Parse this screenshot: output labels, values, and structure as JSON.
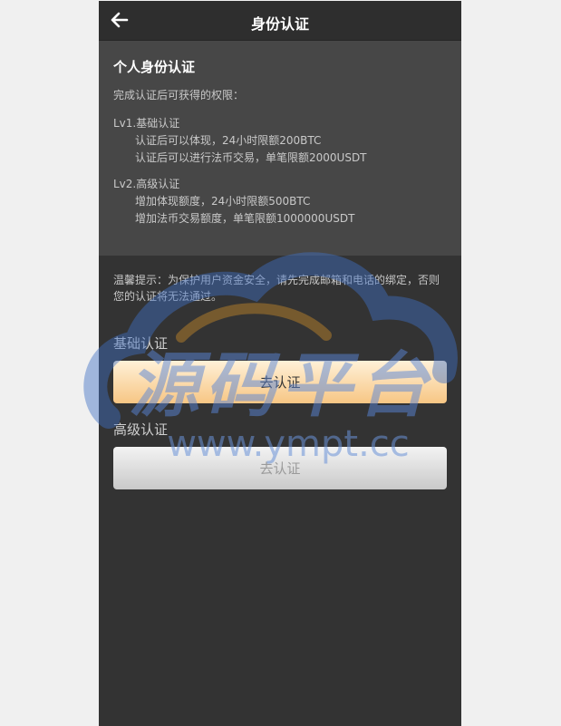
{
  "header": {
    "title": "身份认证",
    "back_icon": "arrow-left-icon"
  },
  "info": {
    "title": "个人身份认证",
    "subtitle": "完成认证后可获得的权限：",
    "levels": [
      {
        "title": "Lv1.基础认证",
        "lines": [
          "认证后可以体现，24小时限额200BTC",
          "认证后可以进行法币交易，单笔限额2000USDT"
        ]
      },
      {
        "title": "Lv2.高级认证",
        "lines": [
          "增加体现额度，24小时限额500BTC",
          "增加法币交易额度，单笔限额1000000USDT"
        ]
      }
    ]
  },
  "tip": "温馨提示：为保护用户资金安全，请先完成邮箱和电话的绑定，否则您的认证将无法通过。",
  "basic": {
    "label": "基础认证",
    "button": "去认证"
  },
  "advanced": {
    "label": "高级认证",
    "button": "去认证"
  },
  "watermark": {
    "text": "源码平台",
    "url": "www.ympt.cc"
  },
  "colors": {
    "background": "#333333",
    "info_bg": "#474747",
    "accent_gold": "#f7c684",
    "watermark_blue": "#5a86d6"
  }
}
